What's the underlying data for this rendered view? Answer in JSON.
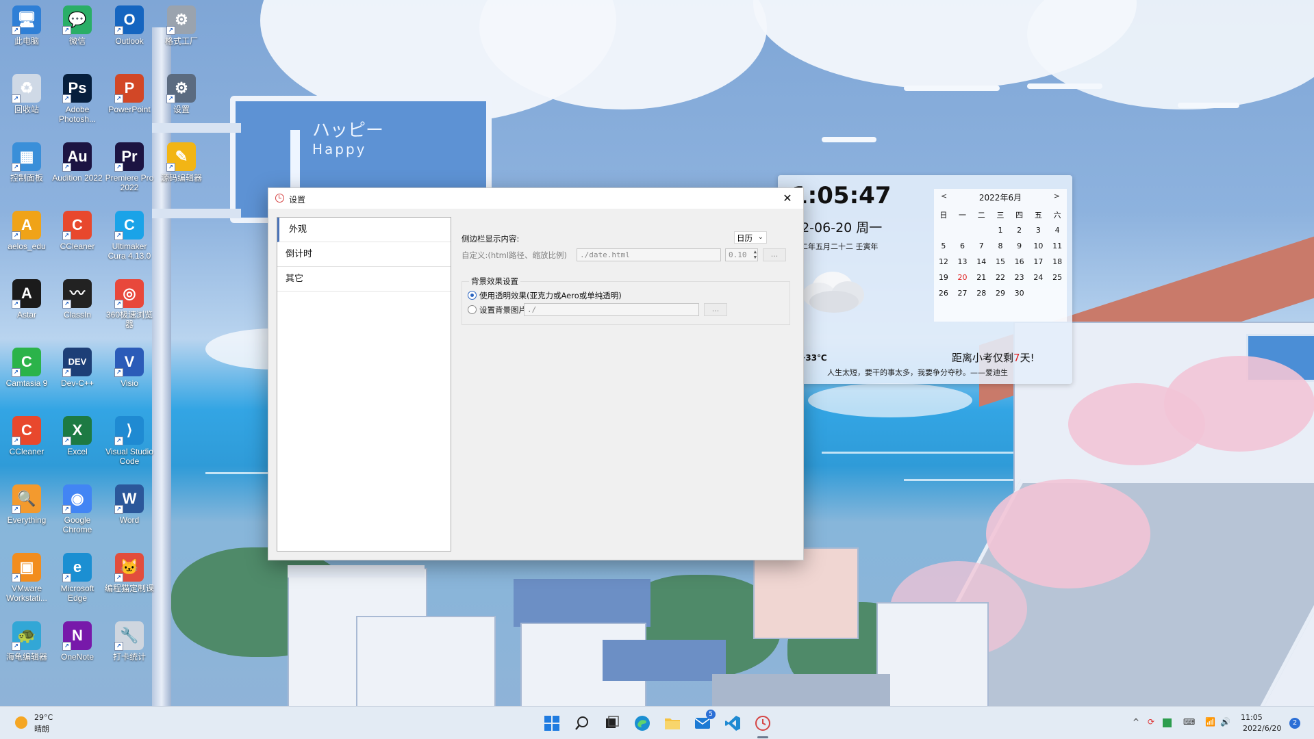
{
  "desktop_icons": [
    {
      "label": "此电脑",
      "glyph": "🖥",
      "color": "#2f7fd6",
      "icon": "computer-icon"
    },
    {
      "label": "微信",
      "glyph": "💬",
      "color": "#2aae67",
      "icon": "wechat-icon"
    },
    {
      "label": "Outlook",
      "glyph": "O",
      "color": "#1565c0",
      "icon": "outlook-icon"
    },
    {
      "label": "格式工厂",
      "glyph": "⚙",
      "color": "#9aa3ae",
      "icon": "format-factory-icon"
    },
    {
      "label": "回收站",
      "glyph": "♻",
      "color": "#cfd9e6",
      "icon": "recycle-bin-icon"
    },
    {
      "label": "Adobe Photosh...",
      "glyph": "Ps",
      "color": "#061e3c",
      "icon": "photoshop-icon"
    },
    {
      "label": "PowerPoint",
      "glyph": "P",
      "color": "#d24726",
      "icon": "powerpoint-icon"
    },
    {
      "label": "设置",
      "glyph": "⚙",
      "color": "#5b6b80",
      "icon": "settings-gear-icon"
    },
    {
      "label": "控制面板",
      "glyph": "▦",
      "color": "#3a8fd9",
      "icon": "control-panel-icon"
    },
    {
      "label": "Audition 2022",
      "glyph": "Au",
      "color": "#1c1442",
      "icon": "audition-icon"
    },
    {
      "label": "Premiere Pro 2022",
      "glyph": "Pr",
      "color": "#1c1442",
      "icon": "premiere-icon"
    },
    {
      "label": "源码编辑器",
      "glyph": "✎",
      "color": "#f2b515",
      "icon": "code-editor-icon"
    },
    {
      "label": "aelos_edu",
      "glyph": "A",
      "color": "#f0a318",
      "icon": "aelos-icon"
    },
    {
      "label": "CCleaner",
      "glyph": "C",
      "color": "#e8482d",
      "icon": "ccleaner-icon"
    },
    {
      "label": "Ultimaker Cura 4.13.0",
      "glyph": "C",
      "color": "#1aa3e8",
      "icon": "cura-icon"
    },
    {
      "label": "",
      "glyph": "",
      "color": "transparent",
      "icon": "empty-slot"
    },
    {
      "label": "Astar",
      "glyph": "A",
      "color": "#1b1b1b",
      "icon": "astar-icon"
    },
    {
      "label": "ClassIn",
      "glyph": "〰",
      "color": "#222222",
      "icon": "classin-icon"
    },
    {
      "label": "360极速浏览器",
      "glyph": "◎",
      "color": "#e8483b",
      "icon": "browser-360-icon"
    },
    {
      "label": "",
      "glyph": "",
      "color": "transparent",
      "icon": "empty-slot"
    },
    {
      "label": "Camtasia 9",
      "glyph": "C",
      "color": "#2bb34a",
      "icon": "camtasia-icon"
    },
    {
      "label": "Dev-C++",
      "glyph": "DEV",
      "color": "#1d3f77",
      "icon": "devcpp-icon"
    },
    {
      "label": "Visio",
      "glyph": "V",
      "color": "#2b5bb8",
      "icon": "visio-icon"
    },
    {
      "label": "",
      "glyph": "",
      "color": "transparent",
      "icon": "empty-slot"
    },
    {
      "label": "CCleaner",
      "glyph": "C",
      "color": "#e8482d",
      "icon": "ccleaner-icon"
    },
    {
      "label": "Excel",
      "glyph": "X",
      "color": "#1d7a43",
      "icon": "excel-icon"
    },
    {
      "label": "Visual Studio Code",
      "glyph": "⟩",
      "color": "#1f8ad2",
      "icon": "vscode-icon"
    },
    {
      "label": "",
      "glyph": "",
      "color": "transparent",
      "icon": "empty-slot"
    },
    {
      "label": "Everything",
      "glyph": "🔍",
      "color": "#f39a2e",
      "icon": "everything-search-icon"
    },
    {
      "label": "Google Chrome",
      "glyph": "◉",
      "color": "#4285f4",
      "icon": "chrome-icon"
    },
    {
      "label": "Word",
      "glyph": "W",
      "color": "#2b579a",
      "icon": "word-icon"
    },
    {
      "label": "",
      "glyph": "",
      "color": "transparent",
      "icon": "empty-slot"
    },
    {
      "label": "VMware Workstati...",
      "glyph": "▣",
      "color": "#f28d1e",
      "icon": "vmware-icon"
    },
    {
      "label": "Microsoft Edge",
      "glyph": "e",
      "color": "#1b8fd2",
      "icon": "edge-icon"
    },
    {
      "label": "编程猫定制课",
      "glyph": "🐱",
      "color": "#e24d3c",
      "icon": "codemao-icon"
    },
    {
      "label": "",
      "glyph": "",
      "color": "transparent",
      "icon": "empty-slot"
    },
    {
      "label": "海龟编辑器",
      "glyph": "🐢",
      "color": "#32a7d6",
      "icon": "turtle-editor-icon"
    },
    {
      "label": "OneNote",
      "glyph": "N",
      "color": "#7719aa",
      "icon": "onenote-icon"
    },
    {
      "label": "打卡统计",
      "glyph": "🔧",
      "color": "#cfd6df",
      "icon": "checkin-stats-icon"
    },
    {
      "label": "",
      "glyph": "",
      "color": "transparent",
      "icon": "empty-slot"
    }
  ],
  "billboard": {
    "line1": "ハッピー",
    "line2": "Happy"
  },
  "widget": {
    "time": "1:05:47",
    "date": "22-06-20 周一",
    "lunar": "二二年五月二十二 壬寅年",
    "temperature": "4~33℃",
    "countdown_prefix": "距离小考仅剩",
    "countdown_days": "7",
    "countdown_suffix": "天!",
    "quote": "人生太短，要干的事太多，我要争分夺秒。——爱迪生",
    "calendar": {
      "title": "2022年6月",
      "prev": "<",
      "next": ">",
      "weekdays": [
        "日",
        "一",
        "二",
        "三",
        "四",
        "五",
        "六"
      ],
      "weeks": [
        [
          "",
          "",
          "",
          "1",
          "2",
          "3",
          "4"
        ],
        [
          "5",
          "6",
          "7",
          "8",
          "9",
          "10",
          "11"
        ],
        [
          "12",
          "13",
          "14",
          "15",
          "16",
          "17",
          "18"
        ],
        [
          "19",
          "20",
          "21",
          "22",
          "23",
          "24",
          "25"
        ],
        [
          "26",
          "27",
          "28",
          "29",
          "30",
          "",
          ""
        ]
      ],
      "today": "20"
    }
  },
  "dialog": {
    "title": "设置",
    "close": "✕",
    "nav": [
      "外观",
      "倒计时",
      "其它"
    ],
    "sidebar_label": "侧边栏显示内容:",
    "sidebar_value": "日历",
    "custom_label": "自定义:(html路径、缩放比例)",
    "custom_path": "./date.html",
    "custom_zoom": "0.10",
    "browse": "...",
    "group_title": "背景效果设置",
    "radio_transparent": "使用透明效果(亚克力或Aero或单纯透明)",
    "radio_image": "设置背景图片",
    "image_path": "./"
  },
  "taskbar": {
    "weather_temp": "29°C",
    "weather_desc": "晴朗",
    "mail_badge": "5",
    "time": "11:05",
    "date": "2022/6/20",
    "notifications": "2",
    "tray_up": "^"
  },
  "colors": {
    "accent": "#2a64c0",
    "today": "#e02020",
    "taskbar": "#e2eaf4"
  }
}
